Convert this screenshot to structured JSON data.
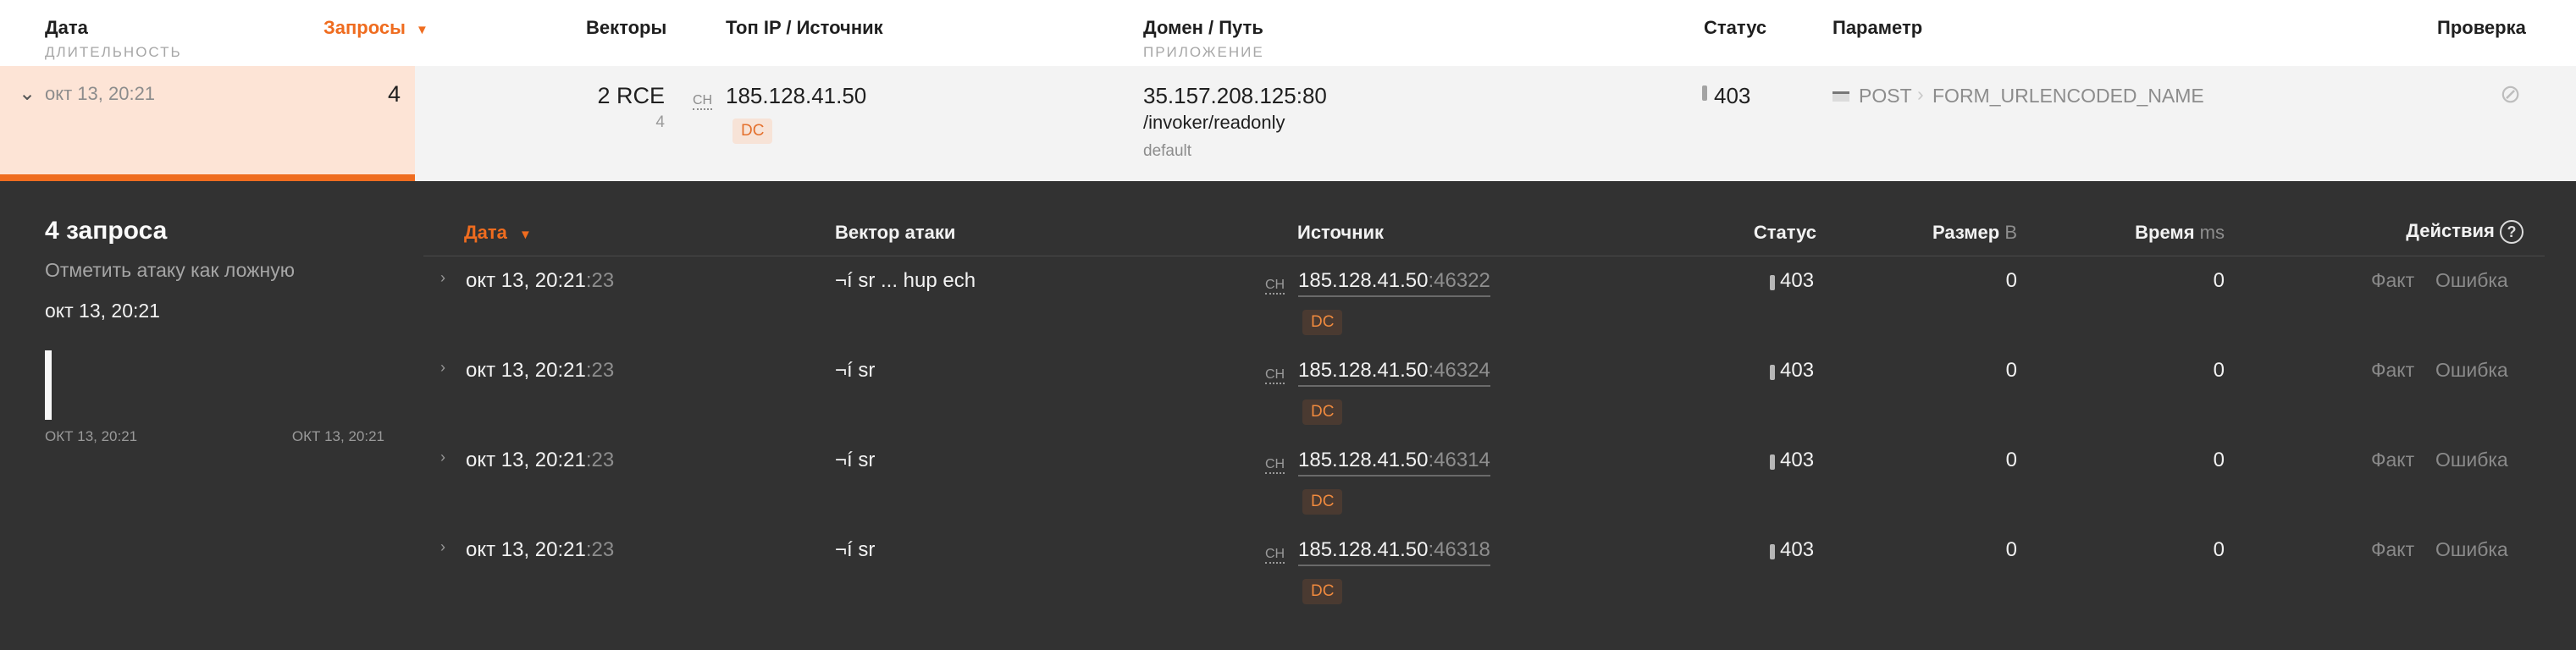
{
  "header": {
    "date_label": "Дата",
    "duration_label": "ДЛИТЕЛЬНОСТЬ",
    "requests_label": "Запросы",
    "sort_arrow": "▼",
    "vectors_label": "Векторы",
    "top_ip_label": "Топ IP / Источник",
    "domain_label": "Домен / Путь",
    "app_label": "ПРИЛОЖЕНИЕ",
    "status_label": "Статус",
    "param_label": "Параметр",
    "check_label": "Проверка"
  },
  "attack": {
    "chevron": "⌄",
    "date": "окт 13, 20:21",
    "requests": "4",
    "vector_main": "2 RCE",
    "vector_count": "4",
    "ip_tag": "CH",
    "ip": "185.128.41.50",
    "ip_badge": "DC",
    "domain": "35.157.208.125:80",
    "path": "/invoker/readonly",
    "app": "default",
    "status": "403",
    "param_method": "POST",
    "param_separator": "›",
    "param_name": "FORM_URLENCODED_NAME",
    "check_icon": "⊘"
  },
  "details": {
    "title": "4 запроса",
    "mark_false": "Отметить атаку как ложную",
    "date": "окт 13, 20:21",
    "timeline_start": "ОКТ 13, 20:21",
    "timeline_end": "ОКТ 13, 20:21",
    "columns": {
      "date": "Дата",
      "sort_arrow": "▼",
      "vector": "Вектор атаки",
      "source": "Источник",
      "status": "Статус",
      "size": "Размер",
      "size_unit": "B",
      "time": "Время",
      "time_unit": "ms",
      "actions": "Действия",
      "help_icon": "?"
    },
    "rows": [
      {
        "chevron": "›",
        "date": "окт 13, 20:21",
        "seconds": ":23",
        "vector": "¬í sr ... hup ech",
        "tag": "CH",
        "ip": "185.128.41.50",
        "port": ":46322",
        "badge": "DC",
        "status": "403",
        "size": "0",
        "time": "0",
        "fact": "Факт",
        "error": "Ошибка"
      },
      {
        "chevron": "›",
        "date": "окт 13, 20:21",
        "seconds": ":23",
        "vector": "¬í sr",
        "tag": "CH",
        "ip": "185.128.41.50",
        "port": ":46324",
        "badge": "DC",
        "status": "403",
        "size": "0",
        "time": "0",
        "fact": "Факт",
        "error": "Ошибка"
      },
      {
        "chevron": "›",
        "date": "окт 13, 20:21",
        "seconds": ":23",
        "vector": "¬í sr",
        "tag": "CH",
        "ip": "185.128.41.50",
        "port": ":46314",
        "badge": "DC",
        "status": "403",
        "size": "0",
        "time": "0",
        "fact": "Факт",
        "error": "Ошибка"
      },
      {
        "chevron": "›",
        "date": "окт 13, 20:21",
        "seconds": ":23",
        "vector": "¬í sr",
        "tag": "CH",
        "ip": "185.128.41.50",
        "port": ":46318",
        "badge": "DC",
        "status": "403",
        "size": "0",
        "time": "0",
        "fact": "Факт",
        "error": "Ошибка"
      }
    ]
  },
  "colors": {
    "accent": "#ef6c1f",
    "panel_bg": "#323232",
    "row_highlight": "#fde4d6"
  }
}
